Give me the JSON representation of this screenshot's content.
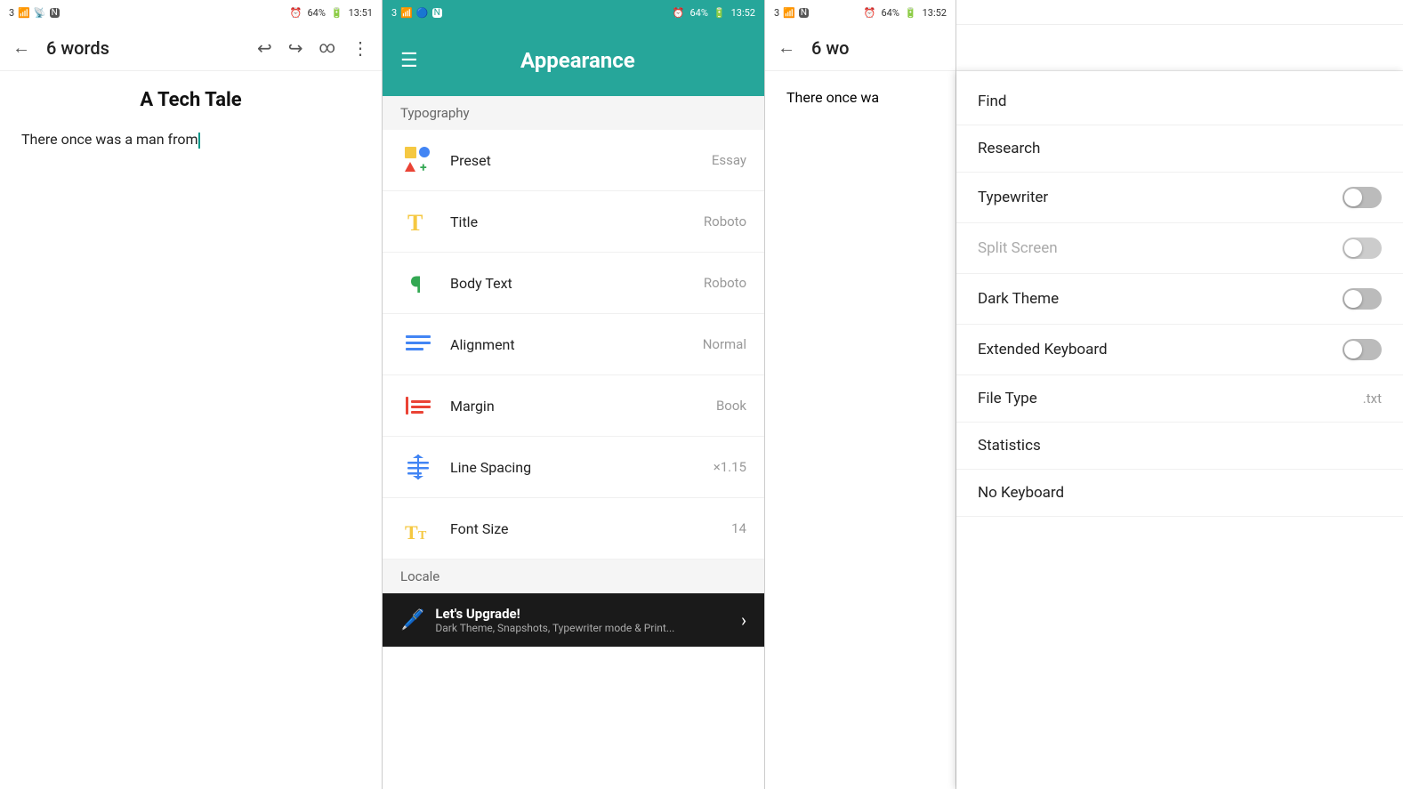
{
  "panel1": {
    "statusBar": {
      "signal": "3",
      "time": "13:51",
      "battery": "64%"
    },
    "toolbar": {
      "title": "6 words",
      "backIcon": "←",
      "undoIcon": "↩",
      "redoIcon": "↪",
      "loopIcon": "∞",
      "moreIcon": "⋮"
    },
    "document": {
      "title": "A Tech Tale",
      "body": "There once was a man from"
    }
  },
  "panel2": {
    "statusBar": {
      "signal": "3",
      "time": "13:52",
      "battery": "64%"
    },
    "header": {
      "title": "Appearance",
      "hamburgerIcon": "☰"
    },
    "sections": [
      {
        "name": "Typography",
        "items": [
          {
            "label": "Preset",
            "value": "Essay",
            "iconType": "preset"
          },
          {
            "label": "Title",
            "value": "Roboto",
            "iconType": "title"
          },
          {
            "label": "Body Text",
            "value": "Roboto",
            "iconType": "bodytext"
          },
          {
            "label": "Alignment",
            "value": "Normal",
            "iconType": "alignment"
          },
          {
            "label": "Margin",
            "value": "Book",
            "iconType": "margin"
          },
          {
            "label": "Line Spacing",
            "value": "×1.15",
            "iconType": "linespacing"
          },
          {
            "label": "Font Size",
            "value": "14",
            "iconType": "fontsize"
          }
        ]
      },
      {
        "name": "Locale",
        "items": []
      }
    ],
    "upgradeBanner": {
      "title": "Let's Upgrade!",
      "subtitle": "Dark Theme, Snapshots, Typewriter mode & Print...",
      "icon": "🖊️"
    }
  },
  "panel3": {
    "editorStatusBar": {
      "signal": "3",
      "time": "13:52",
      "battery": "64%"
    },
    "toolbar": {
      "title": "6 wo",
      "backIcon": "←"
    },
    "document": {
      "body": "There once wa"
    },
    "menu": {
      "items": [
        {
          "label": "Find",
          "type": "link",
          "value": ""
        },
        {
          "label": "Research",
          "type": "link",
          "value": ""
        },
        {
          "label": "Typewriter",
          "type": "toggle",
          "value": false
        },
        {
          "label": "Split Screen",
          "type": "toggle",
          "value": false,
          "disabled": true
        },
        {
          "label": "Dark Theme",
          "type": "toggle",
          "value": false
        },
        {
          "label": "Extended Keyboard",
          "type": "toggle",
          "value": false
        },
        {
          "label": "File Type",
          "type": "value",
          "value": ".txt"
        },
        {
          "label": "Statistics",
          "type": "link",
          "value": ""
        },
        {
          "label": "No Keyboard",
          "type": "link",
          "value": ""
        }
      ]
    }
  },
  "icons": {
    "preset": "🟨🔵🔺➕",
    "title": "T",
    "bodytext": "¶",
    "alignment": "≡",
    "margin": "⇥",
    "linespacing": "↕",
    "fontsize": "Tt"
  }
}
